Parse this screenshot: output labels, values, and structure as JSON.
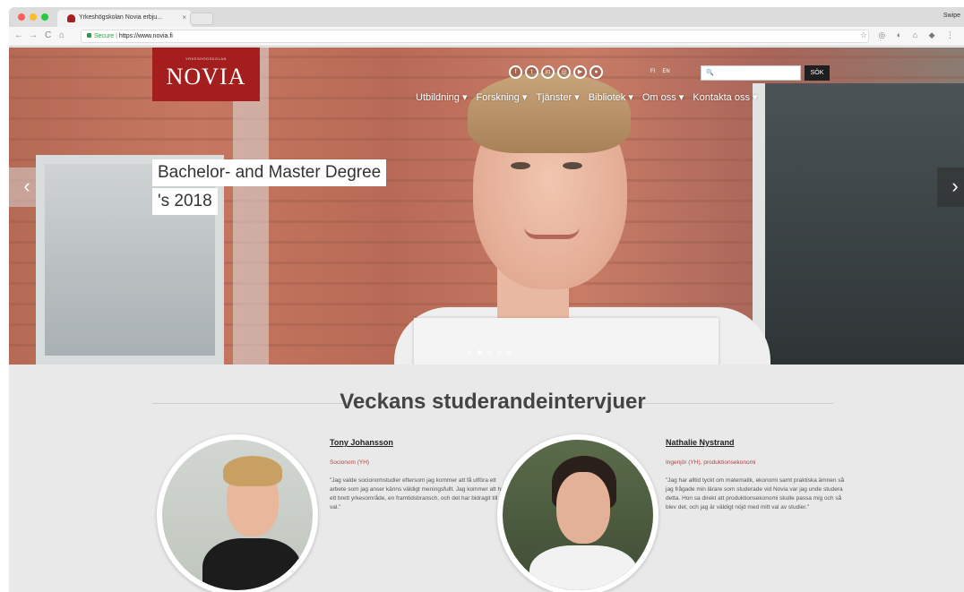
{
  "browser": {
    "tab_title": "Yrkeshögskolan Novia erbju...",
    "tab_close": "×",
    "profile": "Swipe",
    "url_secure": "Secure",
    "url_separator": "|",
    "url": "https://www.novia.fi",
    "nav_back": "←",
    "nav_forward": "→",
    "nav_reload": "C",
    "nav_home": "⌂",
    "toolbar_icons": "☆ ◎ ◐ ⌂ ◆ ⋮"
  },
  "header": {
    "logo_subtitle": "YRKESHÖGSKOLAN",
    "logo_text": "NOVIA",
    "social_icons": [
      "facebook-icon",
      "twitter-icon",
      "linkedin-icon",
      "instagram-icon",
      "youtube-icon",
      "flickr-icon"
    ],
    "social_glyphs": [
      "f",
      "t",
      "in",
      "◎",
      "▶",
      "●"
    ],
    "languages": [
      "FI",
      "EN"
    ],
    "search_placeholder": "🔍",
    "search_button": "SÖK",
    "nav": [
      "Utbildning ▾",
      "Forskning ▾",
      "Tjänster ▾",
      "Bibliotek ▾",
      "Om oss ▾",
      "Kontakta oss ▾"
    ]
  },
  "hero": {
    "caption_line1": "Bachelor- and Master Degree",
    "caption_line2": "'s 2018",
    "prev": "‹",
    "next": "›",
    "slide_count": 5,
    "active_slide": 2
  },
  "section": {
    "title": "Veckans studerandeintervjuer"
  },
  "interviews": [
    {
      "name": "Tony Johansson",
      "role": "Socionom (YH)",
      "quote": "\"Jag valde socionomstudier eftersom jag kommer att få utföra ett arbete som jag anser känns väldigt meningsfullt. Jag kommer att ha ett brett yrkesområde, en framtidsbransch, och det har bidragit till mitt val.\""
    },
    {
      "name": "Nathalie Nystrand",
      "role": "Ingenjör (YH), produktionsekonomi",
      "quote": "\"Jag har alltid tyckt om matematik, ekonomi samt praktiska ämnen så jag frågade min lärare som studerade vid Novia var jag unde studera detta. Hon sa direkt att produktionsekonomi skulle passa mig och så blev det, och jag är väldigt nöjd med mitt val av studier.\""
    }
  ],
  "colors": {
    "brand_red": "#a41e1e",
    "role_red": "#b0413e",
    "secure_green": "#2a9d41"
  }
}
